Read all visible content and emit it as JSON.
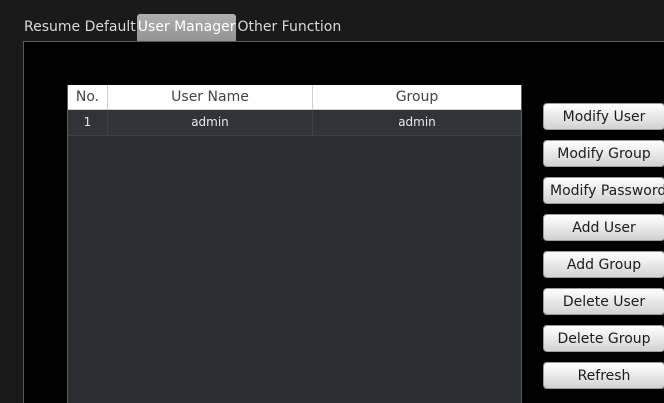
{
  "tabs": [
    {
      "label": "Resume Default",
      "active": false
    },
    {
      "label": "User Manager",
      "active": true
    },
    {
      "label": "Other Function",
      "active": false
    }
  ],
  "table": {
    "headers": [
      "No.",
      "User Name",
      "Group"
    ],
    "rows": [
      {
        "no": "1",
        "user_name": "admin",
        "group": "admin"
      }
    ]
  },
  "buttons": {
    "modify_user": "Modify User",
    "modify_group": "Modify Group",
    "modify_password": "Modify Password",
    "add_user": "Add User",
    "add_group": "Add Group",
    "delete_user": "Delete User",
    "delete_group": "Delete Group",
    "refresh": "Refresh"
  },
  "colors": {
    "background": "#1a1a1a",
    "panel": "#000000",
    "table_body": "#2a2d31",
    "active_tab": "#a3a3a3"
  }
}
